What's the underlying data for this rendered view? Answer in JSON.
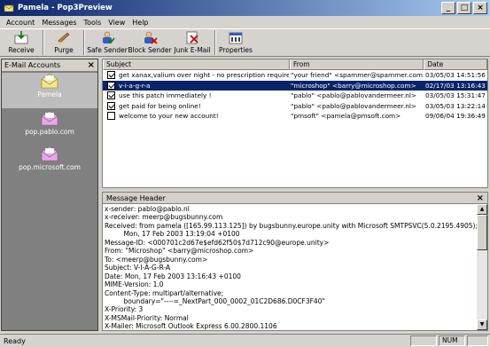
{
  "window": {
    "title": "Pamela - Pop3Preview"
  },
  "menu": [
    "Account",
    "Messages",
    "Tools",
    "View",
    "Help"
  ],
  "toolbar": {
    "receive": "Receive",
    "purge": "Purge",
    "safe_sender": "Safe Sender",
    "block_sender": "Block Sender",
    "junk_email": "Junk E-Mail",
    "properties": "Properties"
  },
  "accounts": {
    "header": "E-Mail Accounts",
    "close": "×",
    "items": [
      {
        "name": "Pamela",
        "color": "#f4e48a"
      },
      {
        "name": "pop.pablo.com",
        "color": "#e8a8e8"
      },
      {
        "name": "pop.microsoft.com",
        "color": "#e8a8e8"
      }
    ]
  },
  "list": {
    "columns": [
      "Subject",
      "From",
      "Date"
    ],
    "rows": [
      {
        "checked": true,
        "subject": "get xanax,valium over night - no prescription required",
        "from": "\"your friend\" <spammer@spammer.com>",
        "date": "03/05/03 14:51:56"
      },
      {
        "checked": true,
        "subject": "v-i-a-g-r-a",
        "from": "\"microshop\" <barry@microshop.com>",
        "date": "02/17/03 13:16:43"
      },
      {
        "checked": true,
        "subject": "use this patch immediately !",
        "from": "\"pablo\" <pablo@pablovandermeer.nl>",
        "date": "03/05/03 15:31:47"
      },
      {
        "checked": true,
        "subject": "get paid for being online!",
        "from": "\"pablo\" <pablo@pablovandermeer.nl>",
        "date": "03/05/03 13:22:14"
      },
      {
        "checked": false,
        "subject": "welcome to your new account!",
        "from": "\"pmsoft\" <pamela@pmsoft.com>",
        "date": "09/06/04 19:36:49"
      }
    ]
  },
  "header_panel": {
    "caption": "Message Header",
    "close": "×",
    "lines": [
      "x-sender: pablo@pablo.nl",
      "x-receiver: meerp@bugsbunny.com",
      "Received: from pamela ([165.99.113.125]) by bugsbunny.europe.unity with Microsoft SMTPSVC(5.0.2195.4905);",
      "         Mon, 17 Feb 2003 13:19:04 +0100",
      "Message-ID: <000701c2d67e$efd62f50$7d712c90@europe.unity>",
      "From: \"Microshop\" <barry@microshop.com>",
      "To: <meerp@bugsbunny.com>",
      "Subject: V-I-A-G-R-A",
      "Date: Mon, 17 Feb 2003 13:16:43 +0100",
      "MIME-Version: 1.0",
      "Content-Type: multipart/alternative;",
      "         boundary=\"----=_NextPart_000_0002_01C2D686.D0CF3F40\"",
      "X-Priority: 3",
      "X-MSMail-Priority: Normal",
      "X-Mailer: Microsoft Outlook Express 6.00.2800.1106"
    ]
  },
  "status": {
    "text": "Ready",
    "num": "NUM"
  },
  "colors": {
    "selection": "#0a246a",
    "face": "#d4d0c8",
    "panel_bg": "#808080"
  }
}
